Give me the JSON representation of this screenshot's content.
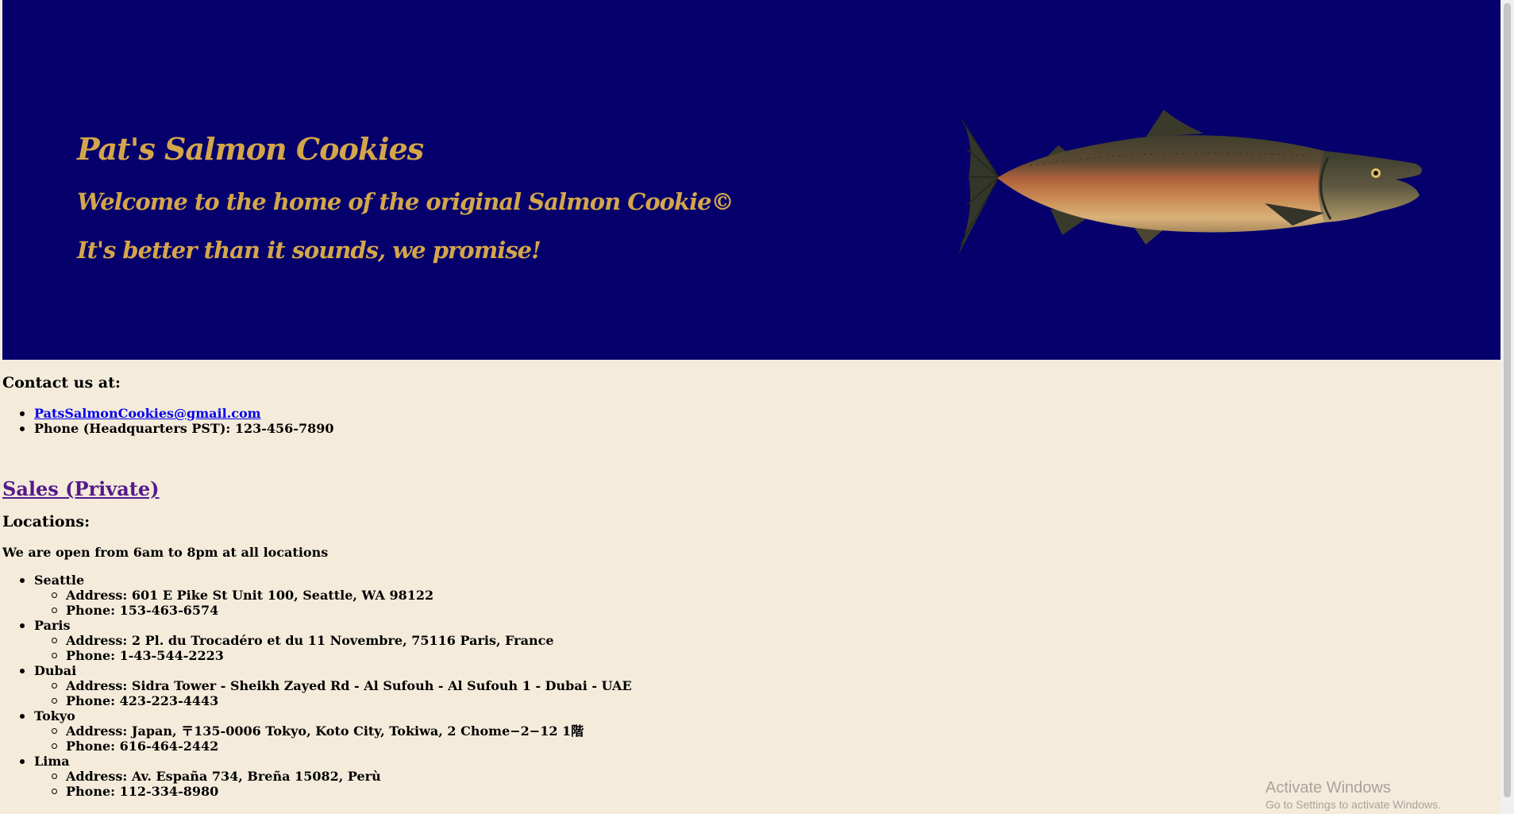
{
  "header": {
    "title": "Pat's Salmon Cookies",
    "welcome": "Welcome to the home of the original Salmon Cookie©",
    "tagline": "It's better than it sounds, we promise!",
    "background_color": "#05006B",
    "text_color": "#D4A64A",
    "image": "salmon-illustration"
  },
  "contact": {
    "heading": "Contact us at:",
    "email": "PatsSalmonCookies@gmail.com",
    "phone": "Phone (Headquarters PST): 123-456-7890"
  },
  "sales_link": "Sales (Private)",
  "locations": {
    "heading": "Locations:",
    "hours": "We are open from 6am to 8pm at all locations",
    "items": [
      {
        "name": "Seattle",
        "address": "Address: 601 E Pike St Unit 100, Seattle, WA 98122",
        "phone": "Phone: 153-463-6574"
      },
      {
        "name": "Paris",
        "address": "Address: 2 Pl. du Trocadéro et du 11 Novembre, 75116 Paris, France",
        "phone": "Phone: 1-43-544-2223"
      },
      {
        "name": "Dubai",
        "address": "Address: Sidra Tower - Sheikh Zayed Rd - Al Sufouh - Al Sufouh 1 - Dubai - UAE",
        "phone": "Phone: 423-223-4443"
      },
      {
        "name": "Tokyo",
        "address": "Address: Japan, 〒135-0006 Tokyo, Koto City, Tokiwa, 2 Chome−2−12 1階",
        "phone": "Phone: 616-464-2442"
      },
      {
        "name": "Lima",
        "address": "Address: Av. España 734, Breña 15082, Perù",
        "phone": "Phone: 112-334-8980"
      }
    ]
  },
  "watermark": {
    "title": "Activate Windows",
    "subtitle": "Go to Settings to activate Windows."
  },
  "colors": {
    "page_background": "#F4EBDB",
    "link": "#0000EE",
    "visited_link": "#551A8B"
  }
}
